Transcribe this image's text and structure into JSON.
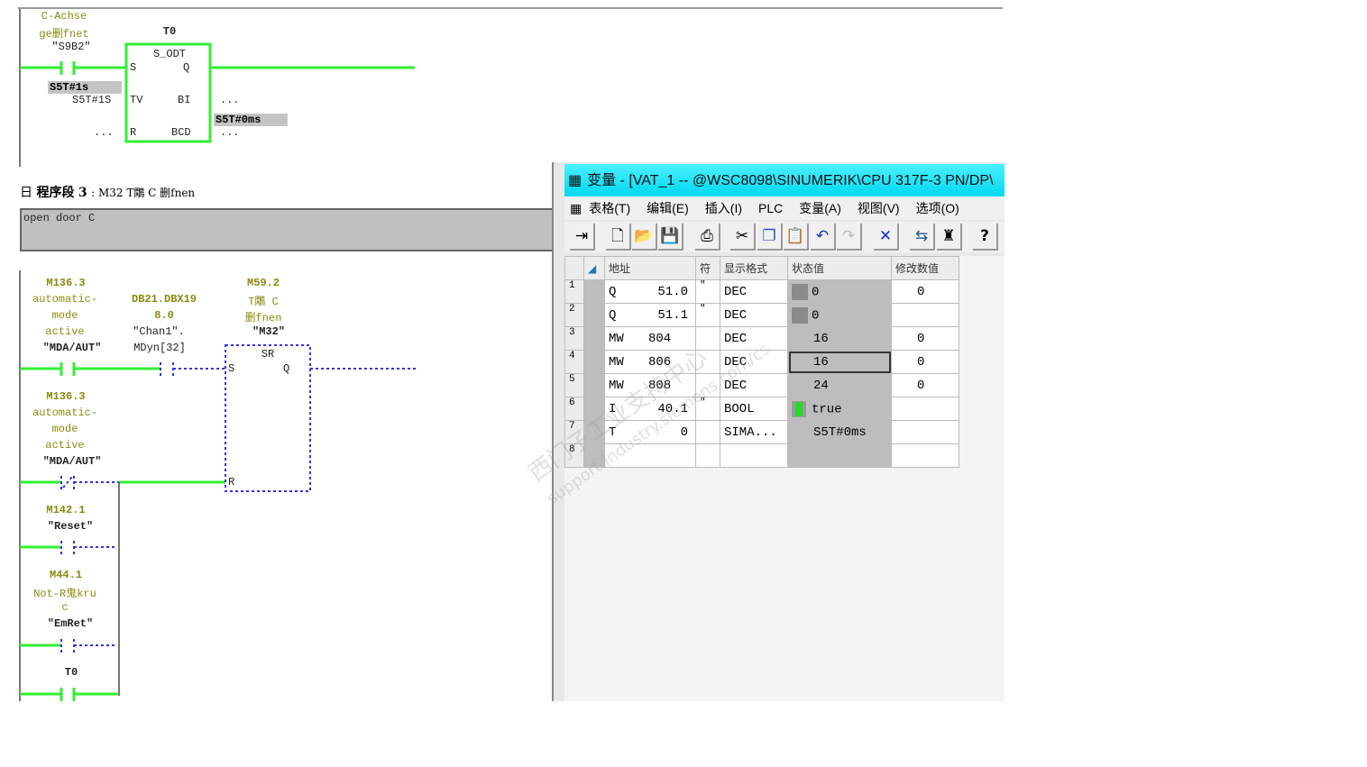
{
  "network2": {
    "contact_symbol": [
      "C-Achse",
      "ge删fnet"
    ],
    "contact_name": "\"S9B2\"",
    "timer_name": "T0",
    "block_type": "S_ODT",
    "pins": {
      "s": "S",
      "q": "Q",
      "tv": "TV",
      "bi": "BI",
      "r": "R",
      "bcd": "BCD"
    },
    "tv_status": "S5T#1s",
    "tv_value": "S5T#1S",
    "bi_out": "...",
    "bi_status": "S5T#0ms",
    "r_in": "...",
    "bcd_out": "..."
  },
  "network3": {
    "header_prefix": "日",
    "header_label": "程序段",
    "header_number": "3",
    "header_title": ": M32 T鷴 C 删fnen",
    "comment": "open door C",
    "contacts": [
      {
        "address": "M136.3",
        "symbol": [
          "automatic-",
          "mode",
          "active"
        ],
        "name": "\"MDA/AUT\""
      },
      {
        "address": "DB21.DBX19",
        "symbol": [
          "8.0"
        ],
        "name": "\"Chan1\".",
        "name2": "MDyn[32]"
      },
      {
        "address": "M136.3",
        "symbol": [
          "automatic-",
          "mode",
          "active"
        ],
        "name": "\"MDA/AUT\""
      },
      {
        "address": "M142.1",
        "symbol": [],
        "name": "\"Reset\""
      },
      {
        "address": "M44.1",
        "symbol": [
          "Not-R鬼kru",
          "c"
        ],
        "name": "\"EmRet\""
      },
      {
        "address": "",
        "symbol": [],
        "name": "T0"
      }
    ],
    "sr": {
      "address": "M59.2",
      "symbol": [
        "T鷴 C",
        "删fnen"
      ],
      "name": "\"M32\"",
      "type": "SR",
      "s": "S",
      "q": "Q",
      "r": "R"
    }
  },
  "vat": {
    "title": "变量 - [VAT_1 -- @WSC8098\\SINUMERIK\\CPU 317F-3 PN/DP\\",
    "menu": [
      "表格(T)",
      "编辑(E)",
      "插入(I)",
      "PLC",
      "变量(A)",
      "视图(V)",
      "选项(O)"
    ],
    "toolbar": [
      "pin-icon",
      "new-icon",
      "open-icon",
      "save-icon",
      "print-icon",
      "cut-icon",
      "copy-icon",
      "paste-icon",
      "undo-icon",
      "redo-icon",
      "delete-icon",
      "monitor-icon",
      "modify-icon",
      "help-icon"
    ],
    "columns": [
      "地址",
      "符",
      "显示格式",
      "状态值",
      "修改数值"
    ],
    "rows": [
      {
        "n": "1",
        "area": "Q",
        "addr": "51.0",
        "sym": "\"",
        "fmt": "DEC",
        "status": "0",
        "modify": "0",
        "status_icon": "forced"
      },
      {
        "n": "2",
        "area": "Q",
        "addr": "51.1",
        "sym": "\"",
        "fmt": "DEC",
        "status": "0",
        "modify": "",
        "status_icon": "forced"
      },
      {
        "n": "3",
        "area": "MW",
        "addr": "804",
        "sym": "",
        "fmt": "DEC",
        "status": "16",
        "modify": "0"
      },
      {
        "n": "4",
        "area": "MW",
        "addr": "806",
        "sym": "",
        "fmt": "DEC",
        "status": "16",
        "modify": "0"
      },
      {
        "n": "5",
        "area": "MW",
        "addr": "808",
        "sym": "",
        "fmt": "DEC",
        "status": "24",
        "modify": "0"
      },
      {
        "n": "6",
        "area": "I",
        "addr": "40.1",
        "sym": "\"",
        "fmt": "BOOL",
        "status": "true",
        "modify": "",
        "status_icon": "green"
      },
      {
        "n": "7",
        "area": "T",
        "addr": "0",
        "sym": "",
        "fmt": "SIMA...",
        "status": "S5T#0ms",
        "modify": ""
      },
      {
        "n": "8",
        "area": "",
        "addr": "",
        "sym": "",
        "fmt": "",
        "status": "",
        "modify": ""
      }
    ]
  },
  "watermark": [
    "西门子工业支持中心",
    "support.industry.siemens.com/cs"
  ],
  "colors": {
    "power_flow": "#33ee33",
    "no_flow": "#3333dd",
    "symbol_text": "#8a8a10",
    "title_bar": "#00d8f0"
  }
}
